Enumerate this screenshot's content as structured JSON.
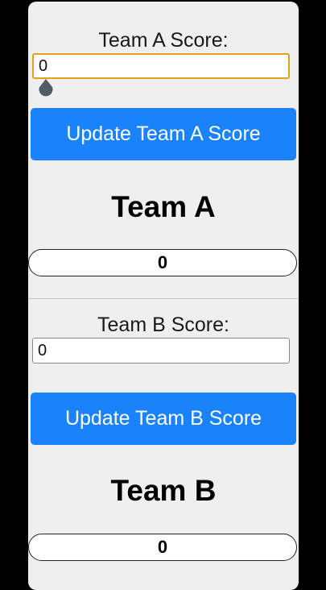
{
  "team_a": {
    "score_label": "Team A Score:",
    "input_value": "0",
    "update_button_label": "Update Team A Score",
    "team_name": "Team A",
    "score_value": "0"
  },
  "team_b": {
    "score_label": "Team B Score:",
    "input_value": "0",
    "update_button_label": "Update Team B Score",
    "team_name": "Team B",
    "score_value": "0"
  },
  "colors": {
    "background": "#000000",
    "card": "#efefef",
    "button": "#1a82fb",
    "focus_border": "#e2a21a"
  },
  "icons": {
    "cursor_handle": "text-cursor-handle-icon"
  }
}
